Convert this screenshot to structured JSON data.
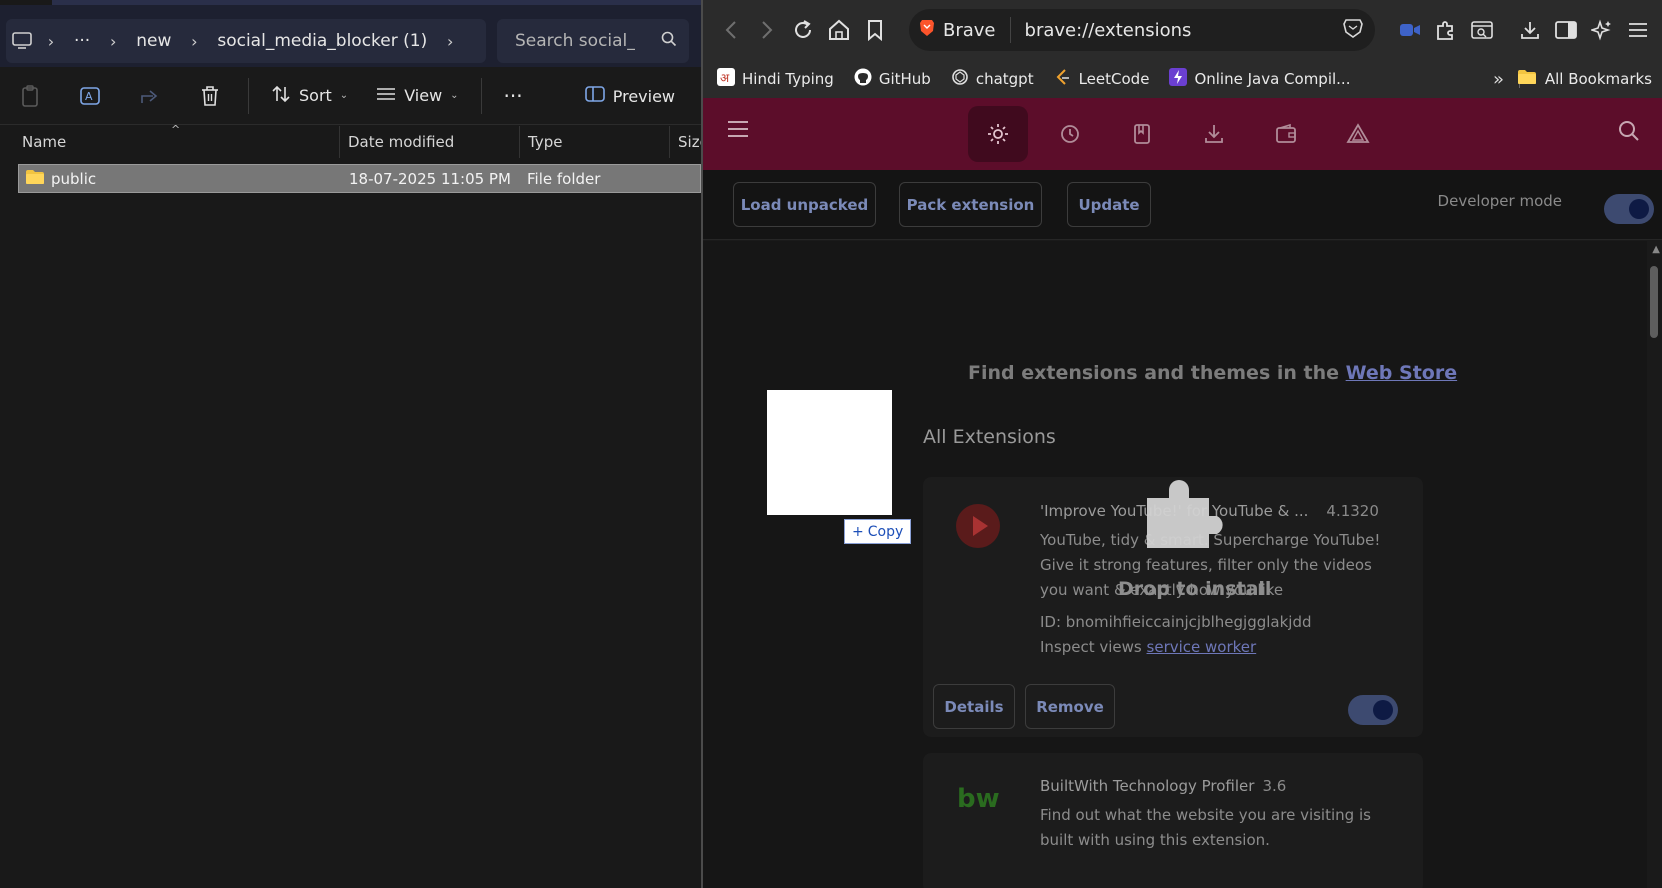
{
  "explorer": {
    "breadcrumb": {
      "more": "···",
      "segments": [
        "new",
        "social_media_blocker (1)"
      ]
    },
    "search_placeholder": "Search social_m",
    "toolbar": {
      "sort_label": "Sort",
      "view_label": "View",
      "more": "···",
      "preview_label": "Preview"
    },
    "columns": [
      "Name",
      "Date modified",
      "Type",
      "Size"
    ],
    "rows": [
      {
        "name": "public",
        "date": "18-07-2025 11:05 PM",
        "type": "File folder"
      }
    ]
  },
  "browser": {
    "brand": "Brave",
    "url": "brave://extensions",
    "bookmarks": [
      "Hindi Typing",
      "GitHub",
      "chatgpt",
      "LeetCode",
      "Online Java Compil..."
    ],
    "bookmarks_more": "»",
    "all_bookmarks": "All Bookmarks",
    "toolbar": {
      "load_unpacked": "Load unpacked",
      "pack_extension": "Pack extension",
      "update": "Update",
      "developer_mode_label": "Developer mode",
      "developer_mode_on": true
    },
    "webstore_prefix": "Find extensions and themes in the",
    "webstore_link": "Web Store",
    "section_title": "All Extensions",
    "extensions": [
      {
        "name": "'Improve YouTube!' for YouTube & ...",
        "version": "4.1320",
        "description": "YouTube, tidy & smart. Supercharge YouTube! Give it strong features, filter only the videos you want & exactly how you like",
        "id_line": "ID: bnomihfieiccainjcjblhegjgglakjdd",
        "inspect_prefix": "Inspect views",
        "inspect_link": "service worker",
        "details_label": "Details",
        "remove_label": "Remove",
        "enabled": true
      },
      {
        "name": "BuiltWith Technology Profiler",
        "version": "3.6",
        "description": "Find out what the website you are visiting is built with using this extension."
      }
    ],
    "drag": {
      "copy_label": "Copy",
      "drop_label": "Drop to install"
    }
  }
}
